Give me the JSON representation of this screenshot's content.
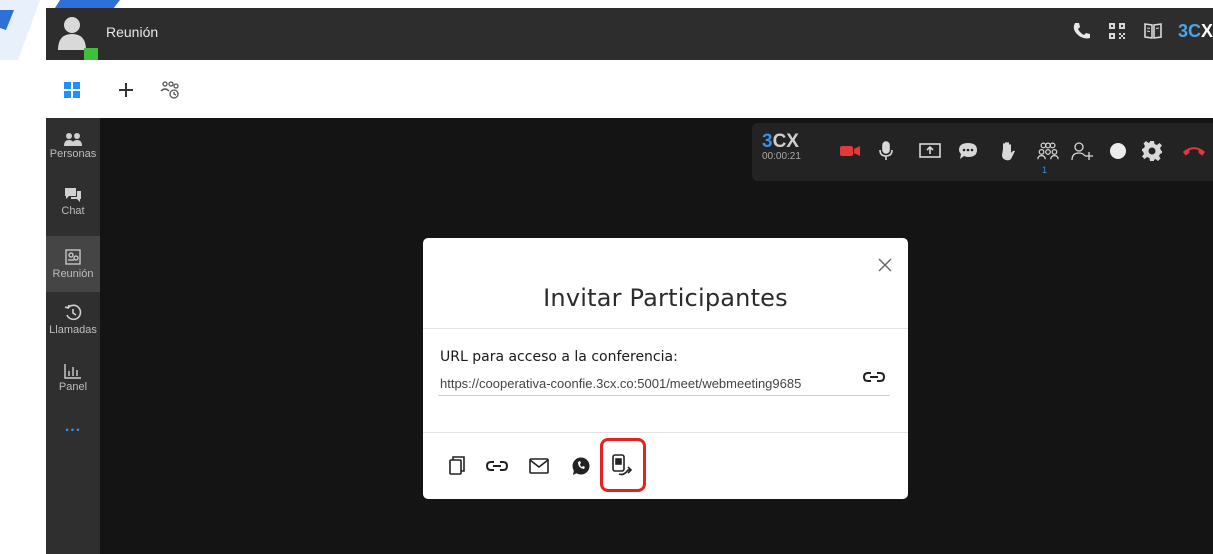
{
  "colors": {
    "titlebar_bg": "#2d2d2d",
    "sidebar_bg": "#2f2f2f",
    "main_bg": "#141414",
    "accent_blue": "#3b8fe0",
    "presence_green": "#3fbf3f",
    "record_red": "#e23a3a",
    "highlight_red": "#e32222"
  },
  "titlebar": {
    "title": "Reunión",
    "icons": [
      "phone-icon",
      "qr-code-icon",
      "book-icon"
    ],
    "brand_prefix": "3C",
    "brand_suffix": "X"
  },
  "toolbar": {
    "icons": [
      "windows-logo-icon",
      "plus-icon",
      "schedule-meeting-icon"
    ]
  },
  "sidebar": {
    "items": [
      {
        "label": "Personas",
        "icon": "people-icon"
      },
      {
        "label": "Chat",
        "icon": "chat-icon"
      },
      {
        "label": "Reunión",
        "icon": "meeting-icon",
        "active": true
      },
      {
        "label": "Llamadas",
        "icon": "history-icon"
      },
      {
        "label": "Panel",
        "icon": "chart-icon"
      }
    ],
    "more": "..."
  },
  "meeting_controls": {
    "brand_prefix": "3",
    "brand_suffix": "CX",
    "timer": "00:00:21",
    "participant_count": "1",
    "icons": [
      "camera-off-icon",
      "microphone-icon",
      "share-screen-icon",
      "chat-bubble-icon",
      "raise-hand-icon",
      "participants-icon",
      "add-participant-icon",
      "record-icon",
      "settings-icon",
      "hangup-icon"
    ]
  },
  "modal": {
    "title": "Invitar Participantes",
    "url_label": "URL para acceso a la conferencia:",
    "url_value": "https://cooperativa-coonfie.3cx.co:5001/meet/webmeeting9685",
    "share_icons": [
      "copy-icon",
      "link-icon",
      "email-icon",
      "whatsapp-icon",
      "share-app-icon"
    ],
    "highlighted": "share-app-icon"
  }
}
